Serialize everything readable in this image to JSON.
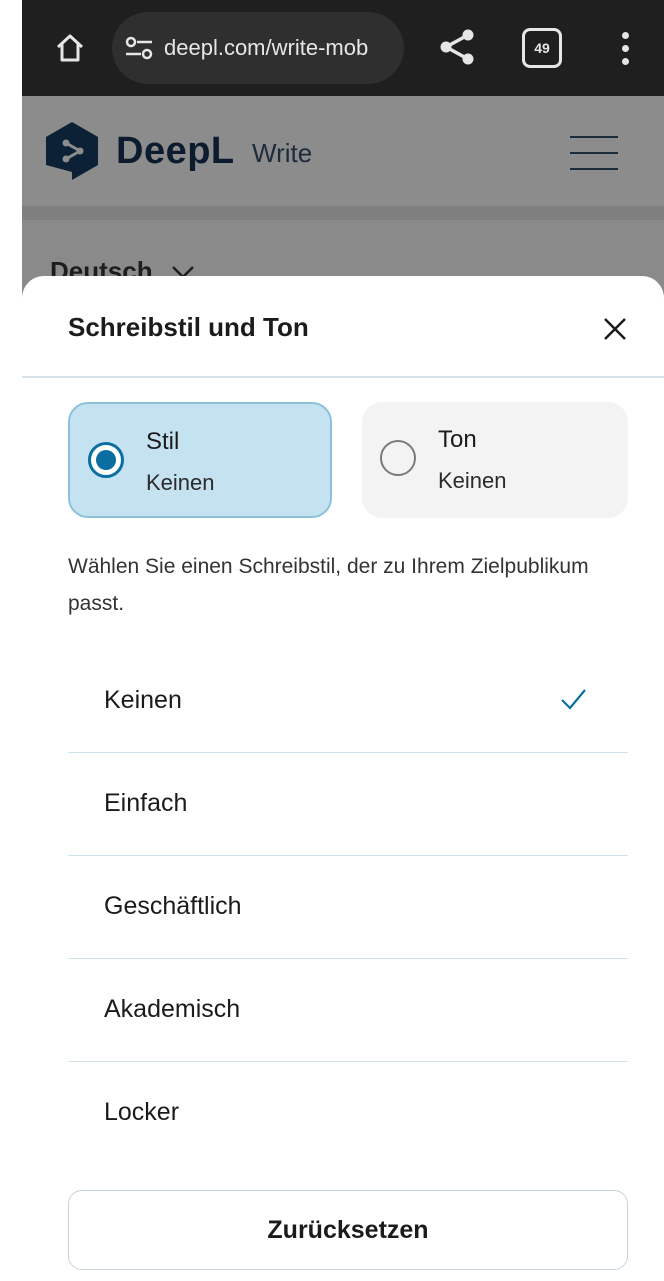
{
  "browser": {
    "url": "deepl.com/write-mob",
    "tab_count": "49"
  },
  "header": {
    "brand": "DeepL",
    "product": "Write"
  },
  "page": {
    "language": "Deutsch"
  },
  "sheet": {
    "title": "Schreibstil und Ton",
    "segments": [
      {
        "label": "Stil",
        "value": "Keinen",
        "selected": true
      },
      {
        "label": "Ton",
        "value": "Keinen",
        "selected": false
      }
    ],
    "hint": "Wählen Sie einen Schreibstil, der zu Ihrem Zielpublikum passt.",
    "options": [
      {
        "label": "Keinen",
        "selected": true
      },
      {
        "label": "Einfach",
        "selected": false
      },
      {
        "label": "Geschäftlich",
        "selected": false
      },
      {
        "label": "Akademisch",
        "selected": false
      },
      {
        "label": "Locker",
        "selected": false
      }
    ],
    "reset_label": "Zurücksetzen"
  },
  "colors": {
    "accent": "#0a6fa0",
    "selected_bg": "#c5e2f1",
    "brand_dark": "#0c1b2e"
  }
}
